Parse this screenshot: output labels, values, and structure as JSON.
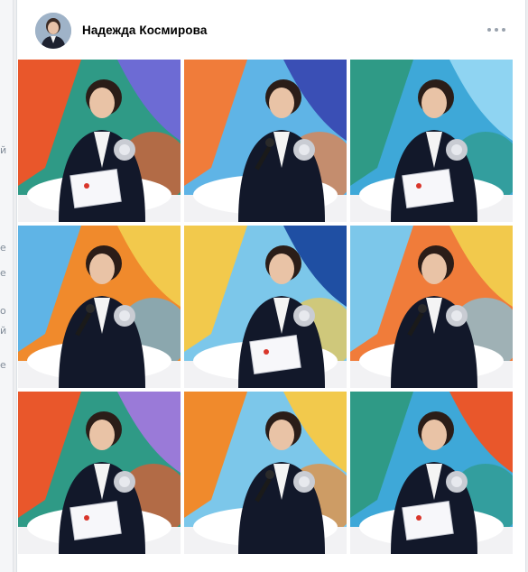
{
  "post": {
    "author_name": "Надежда Космирова",
    "more_icon": "more-horizontal-icon",
    "photos": [
      {
        "alt": "photo-1",
        "bg": "#2f9a86",
        "accent": "#e9572b",
        "accent2": "#6d6bd4"
      },
      {
        "alt": "photo-2",
        "bg": "#5fb4e6",
        "accent": "#f07c3a",
        "accent2": "#3a4fb5"
      },
      {
        "alt": "photo-3",
        "bg": "#3ea8d8",
        "accent": "#2f9a86",
        "accent2": "#8fd4f2"
      },
      {
        "alt": "photo-4",
        "bg": "#f08a2c",
        "accent": "#5fb4e6",
        "accent2": "#f2c94c"
      },
      {
        "alt": "photo-5",
        "bg": "#7cc7ea",
        "accent": "#f2c94c",
        "accent2": "#1f4fa3"
      },
      {
        "alt": "photo-6",
        "bg": "#f07c3a",
        "accent": "#7cc7ea",
        "accent2": "#f2c94c"
      },
      {
        "alt": "photo-7",
        "bg": "#2f9a86",
        "accent": "#e9572b",
        "accent2": "#9a7ad8"
      },
      {
        "alt": "photo-8",
        "bg": "#7cc7ea",
        "accent": "#f08a2c",
        "accent2": "#f2c94c"
      },
      {
        "alt": "photo-9",
        "bg": "#3ea8d8",
        "accent": "#2f9a86",
        "accent2": "#e9572b"
      }
    ]
  },
  "side": {
    "marks": [
      "й",
      "е",
      "е",
      "о",
      "й",
      "е"
    ]
  }
}
